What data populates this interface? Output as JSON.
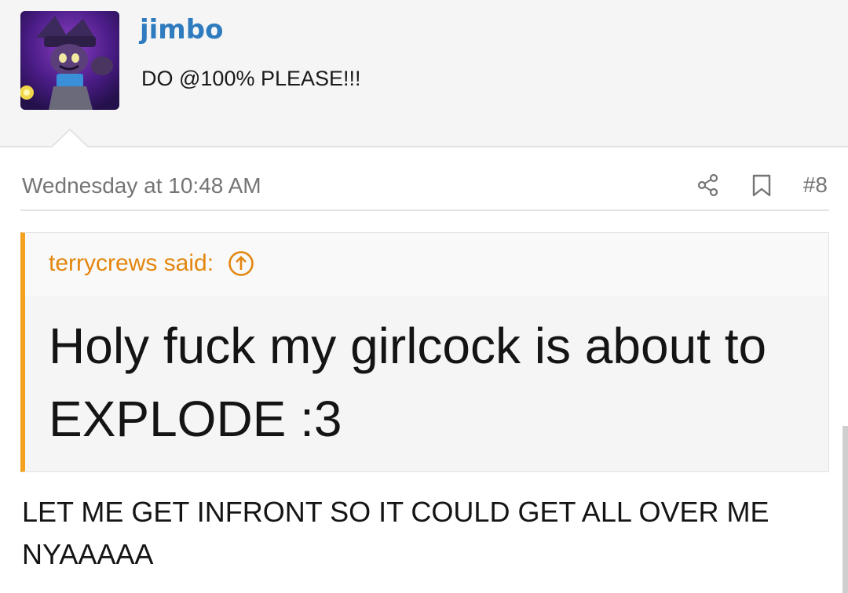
{
  "user": {
    "name": "jimbo",
    "title": "DO @100% PLEASE!!!"
  },
  "post": {
    "date": "Wednesday at 10:48 AM",
    "number": "#8",
    "icons": {
      "share": "share-icon",
      "bookmark": "bookmark-icon",
      "jump": "arrow-up-circle-icon"
    },
    "quote": {
      "author": "terrycrews said:",
      "text": "Holy fuck my girlcock is about to EXPLODE :3"
    },
    "body": "LET ME GET INFRONT SO IT COULD GET ALL OVER ME NYAAAAA"
  },
  "colors": {
    "username": "#2f7bbf",
    "quote_accent": "#f4a11e",
    "quote_author": "#e2860e",
    "muted": "#757575"
  }
}
